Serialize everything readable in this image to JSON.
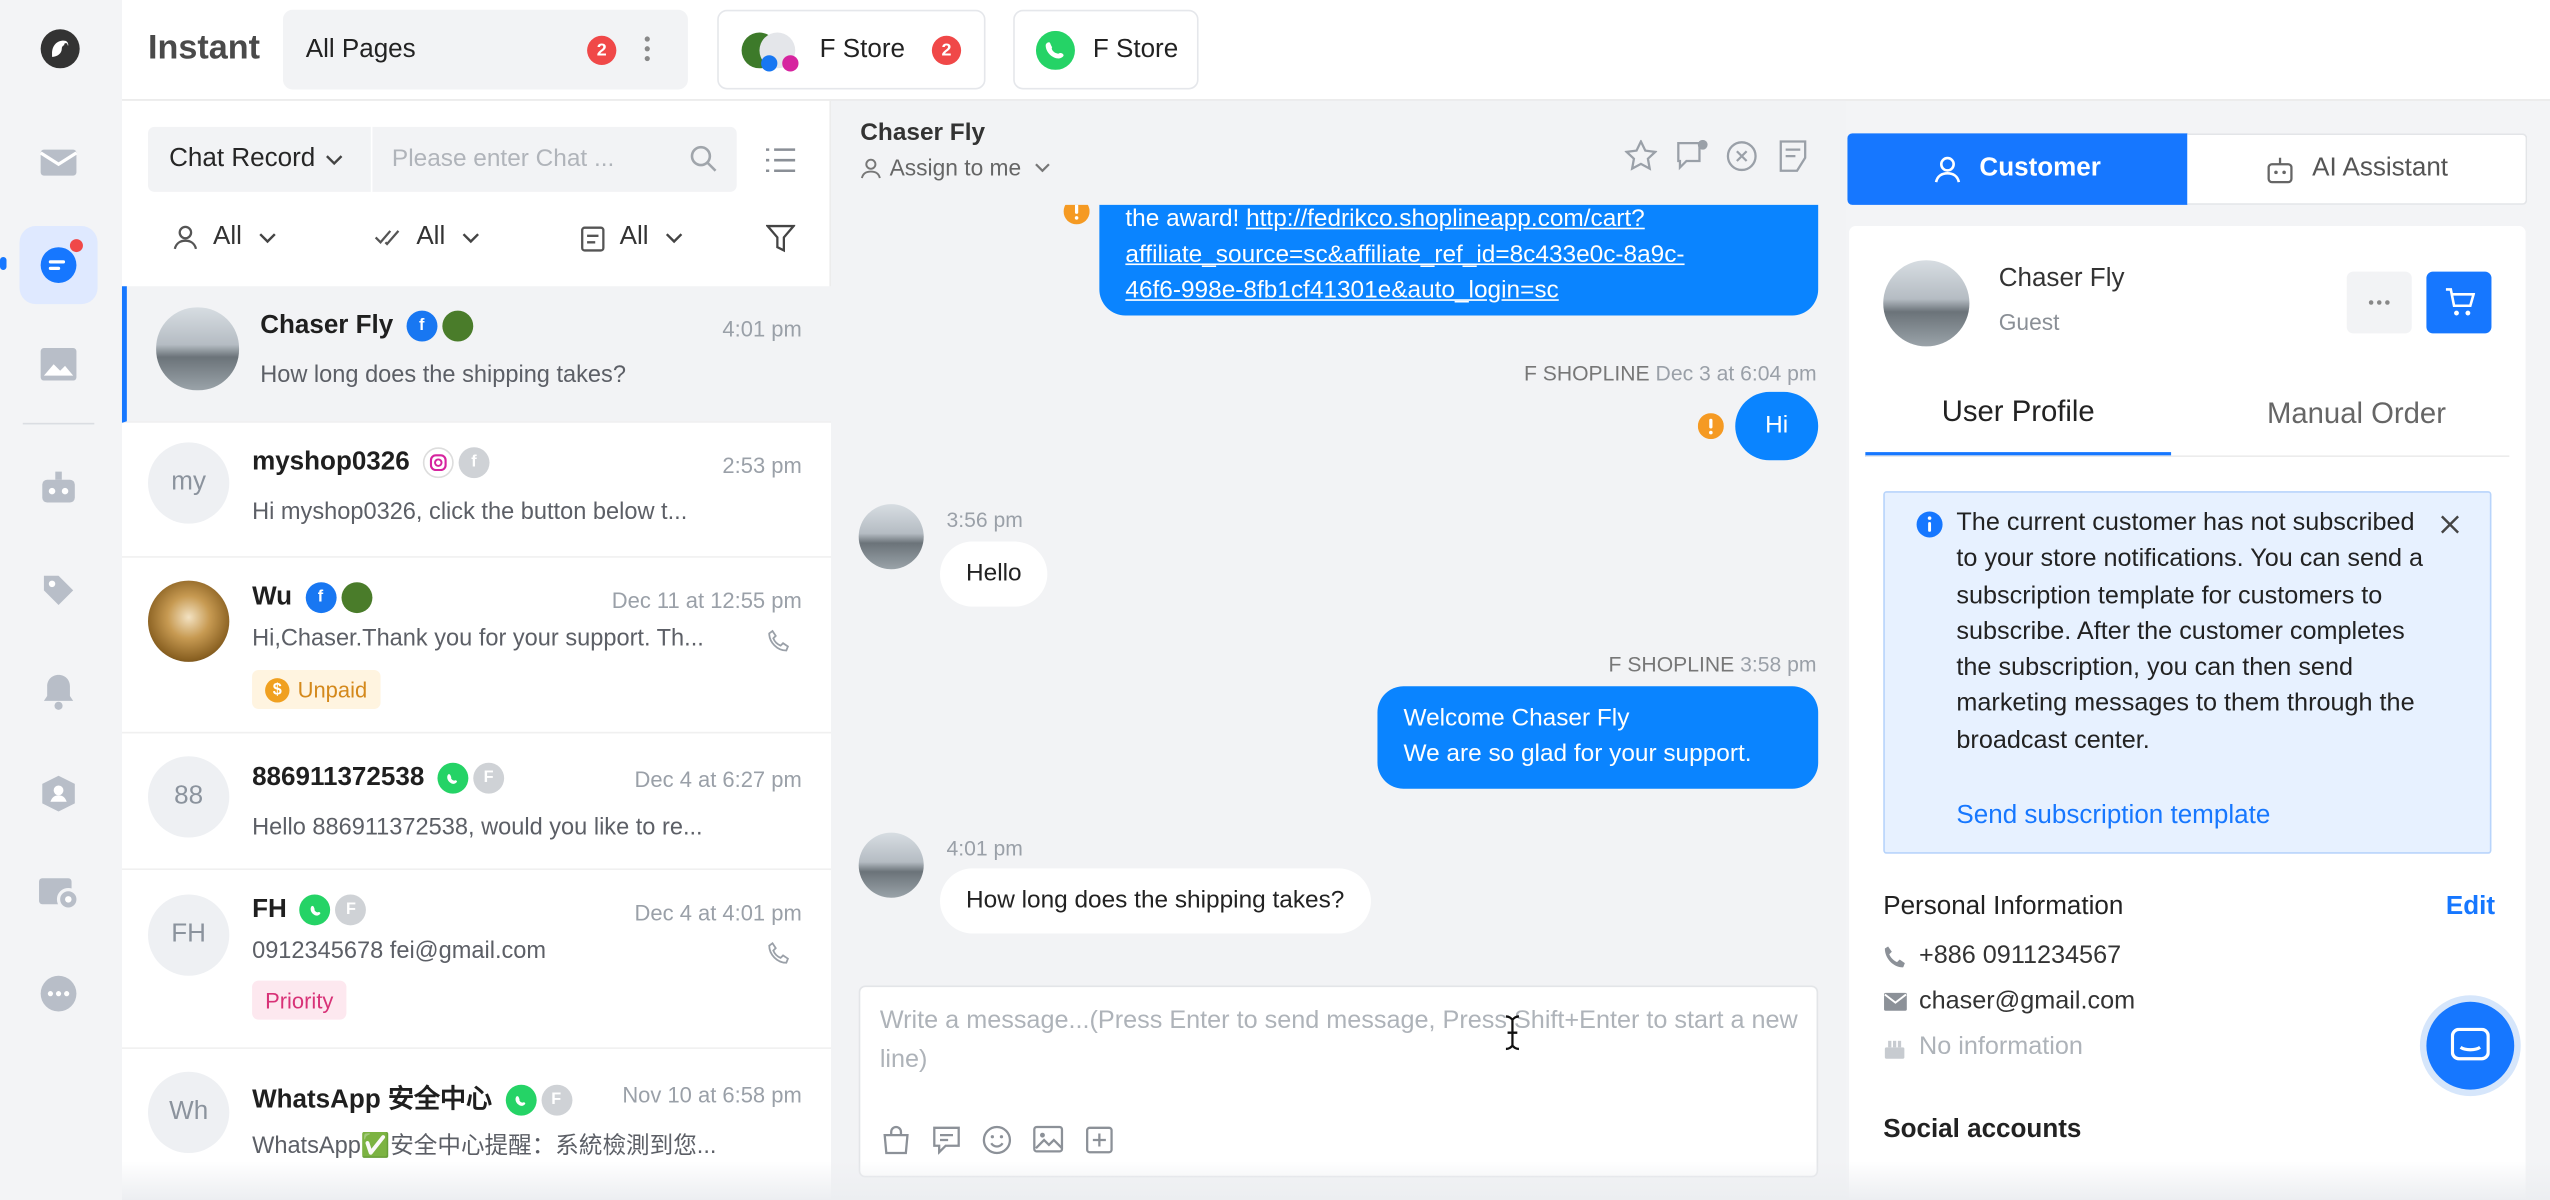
{
  "app": {
    "title": "Instant"
  },
  "tabs": [
    {
      "label": "All Pages",
      "badge": "2"
    },
    {
      "label": "F Store",
      "badge": "2"
    },
    {
      "label": "F Store"
    }
  ],
  "filters": {
    "type_select": "Chat Record",
    "search_placeholder": "Please enter Chat ...",
    "assignee": "All",
    "status": "All",
    "category": "All"
  },
  "conversations": [
    {
      "name": "Chaser Fly",
      "time": "4:01 pm",
      "preview": "How long does the shipping takes?"
    },
    {
      "name": "myshop0326",
      "avatar": "my",
      "time": "2:53 pm",
      "preview": "Hi myshop0326, click the button below t..."
    },
    {
      "name": "Wu",
      "time": "Dec 11 at 12:55 pm",
      "preview": "Hi,Chaser.Thank you for your support. Th...",
      "tag": "Unpaid"
    },
    {
      "name": "886911372538",
      "avatar": "88",
      "time": "Dec 4 at 6:27 pm",
      "preview": "Hello 886911372538, would you like to re..."
    },
    {
      "name": "FH",
      "avatar": "FH",
      "time": "Dec 4 at 4:01 pm",
      "preview": "0912345678 fei@gmail.com",
      "tag": "Priority"
    },
    {
      "name": "WhatsApp 安全中心",
      "avatar": "Wh",
      "time": "Nov 10 at 6:58 pm",
      "preview": "WhatsApp✅安全中心提醒：系統檢測到您..."
    }
  ],
  "chat": {
    "name": "Chaser Fly",
    "assign": "Assign to me",
    "link_prefix": "the award! ",
    "link_lines": [
      "http://fedrikco.shoplineapp.com/cart?",
      "affiliate_source=sc&affiliate_ref_id=8c433e0c-8a9c-",
      "46f6-998e-8fb1cf41301e&auto_login=sc"
    ],
    "m1_sender": "F SHOPLINE",
    "m1_time": "Dec 3 at 6:04 pm",
    "m1_text": "Hi",
    "m2_time": "3:56 pm",
    "m2_text": "Hello",
    "m3_sender": "F SHOPLINE",
    "m3_time": "3:58 pm",
    "m3_line1": "Welcome Chaser Fly",
    "m3_line2": "We are so glad for your support.",
    "m4_time": "4:01 pm",
    "m4_text": "How long does the shipping takes?",
    "composer_placeholder": "Write a message...(Press Enter to send message, Press Shift+Enter to start a new line)"
  },
  "right": {
    "tab_customer": "Customer",
    "tab_ai": "AI Assistant",
    "name": "Chaser Fly",
    "role": "Guest",
    "sub_profile": "User Profile",
    "sub_order": "Manual Order",
    "notice": "The current customer has not subscribed to your store notifications. You can send a subscription template for customers to subscribe. After the customer completes the subscription, you can then send marketing messages to them through the broadcast center.",
    "notice_link": "Send subscription template",
    "personal_title": "Personal Information",
    "edit": "Edit",
    "phone": "+886 0911234567",
    "email": "chaser@gmail.com",
    "birthday": "No information",
    "social_title": "Social accounts"
  },
  "colors": {
    "accent": "#1677ff",
    "bubble_out": "#0a84ff",
    "badge": "#f04848"
  }
}
